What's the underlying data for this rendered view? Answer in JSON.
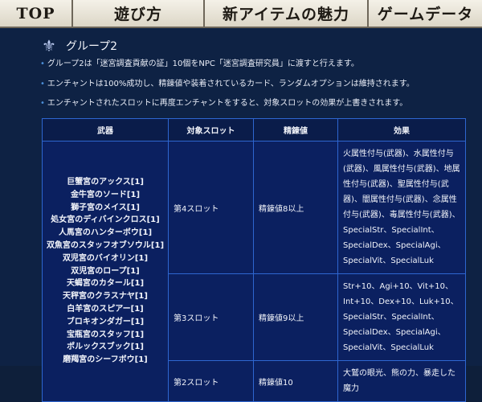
{
  "nav": {
    "items": [
      "TOP",
      "遊び方",
      "新アイテムの魅力",
      "ゲームデータ"
    ]
  },
  "section": {
    "title": "グループ2",
    "bullets": [
      "グループ2は「迷宮調査貢献の証」10個をNPC「迷宮調査研究員」に渡すと行えます。",
      "エンチャントは100%成功し、精錬値や装着されているカード、ランダムオプションは維持されます。",
      "エンチャントされたスロットに再度エンチャントをすると、対象スロットの効果が上書きされます。"
    ]
  },
  "table": {
    "headers": [
      "武器",
      "対象スロット",
      "精錬値",
      "効果"
    ],
    "weapons": [
      "巨蟹宮のアックス[1]",
      "金牛宮のソード[1]",
      "獅子宮のメイス[1]",
      "処女宮のディバインクロス[1]",
      "人馬宮のハンターボウ[1]",
      "双魚宮のスタッフオブソウル[1]",
      "双児宮のバイオリン[1]",
      "双児宮のロープ[1]",
      "天蝎宮のカタール[1]",
      "天秤宮のクラスナヤ[1]",
      "白羊宮のスピアー[1]",
      "ブロキオンダガー[1]",
      "宝瓶宮のスタッフ[1]",
      "ポルックスブック[1]",
      "磨羯宮のシーフボウ[1]"
    ],
    "rows": [
      {
        "slot": "第4スロット",
        "refine": "精錬値8以上",
        "effect": "火属性付与(武器)、水属性付与(武器)、風属性付与(武器)、地属性付与(武器)、聖属性付与(武器)、闇属性付与(武器)、念属性付与(武器)、毒属性付与(武器)、SpecialStr、SpecialInt、SpecialDex、SpecialAgi、SpecialVit、SpecialLuk"
      },
      {
        "slot": "第3スロット",
        "refine": "精錬値9以上",
        "effect": "Str+10、Agi+10、Vit+10、Int+10、Dex+10、Luk+10、SpecialStr、SpecialInt、SpecialDex、SpecialAgi、SpecialVit、SpecialLuk"
      },
      {
        "slot": "第2スロット",
        "refine": "精錬値10",
        "effect": "大鷲の眼光、熊の力、暴走した魔力"
      }
    ]
  }
}
